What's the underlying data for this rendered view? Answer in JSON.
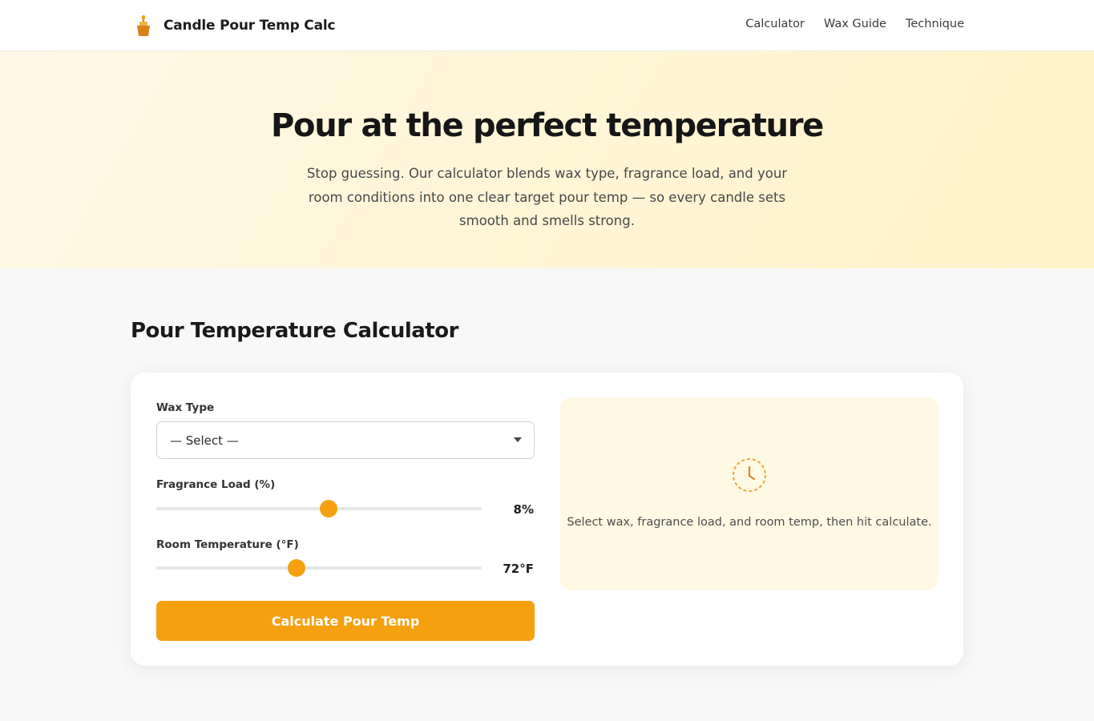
{
  "header": {
    "brand_name": "Candle Pour Temp Calc",
    "brand_icon": "candle-icon",
    "nav": [
      {
        "label": "Calculator"
      },
      {
        "label": "Wax Guide"
      },
      {
        "label": "Technique"
      }
    ]
  },
  "hero": {
    "title": "Pour at the perfect temperature",
    "subtitle": "Stop guessing. Our calculator blends wax type, fragrance load, and your room conditions into one clear target pour temp — so every candle sets smooth and smells strong."
  },
  "calculator": {
    "title": "Pour Temperature Calculator",
    "wax_type": {
      "label": "Wax Type",
      "selected": "— Select —"
    },
    "fragrance": {
      "label": "Fragrance Load (%)",
      "value_text": "8%",
      "level_fraction": 0.53
    },
    "room_temp": {
      "label": "Room Temperature (°F)",
      "value_text": "72°F",
      "level_fraction": 0.43
    },
    "button_label": "Calculate Pour Temp",
    "result": {
      "icon": "clock-icon",
      "placeholder": "Select wax, fragrance load, and room temp, then hit calculate."
    }
  },
  "colors": {
    "accent": "#f5a00f",
    "hero_bg": "#fff6d8",
    "result_bg": "#fff9e3"
  }
}
